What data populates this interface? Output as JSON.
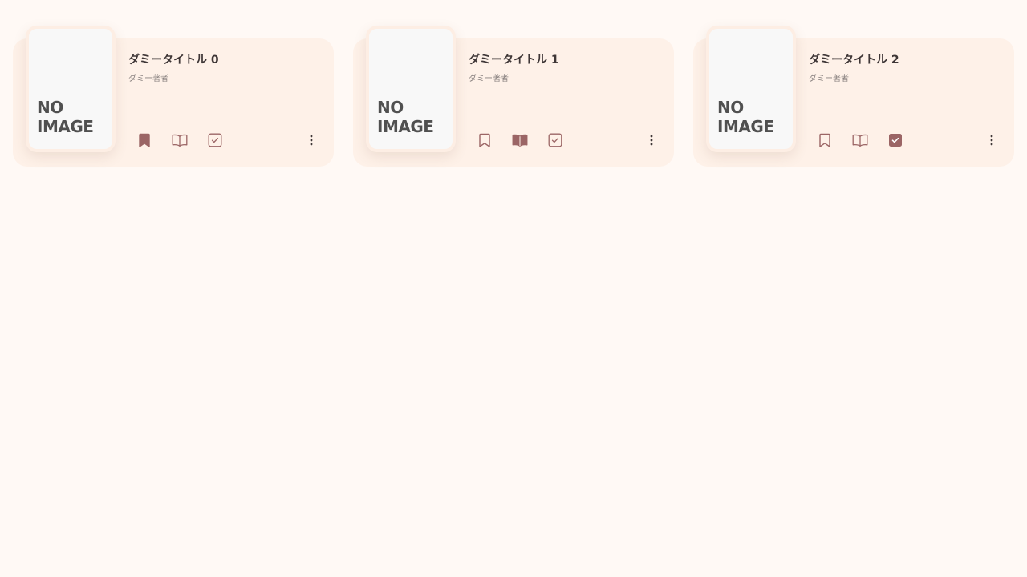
{
  "cards": [
    {
      "title": "ダミータイトル 0",
      "author": "ダミー著者",
      "cover_text": "NO\nIMAGE",
      "states": {
        "bookmark": true,
        "reading": false,
        "done": false
      }
    },
    {
      "title": "ダミータイトル 1",
      "author": "ダミー著者",
      "cover_text": "NO\nIMAGE",
      "states": {
        "bookmark": false,
        "reading": true,
        "done": false
      }
    },
    {
      "title": "ダミータイトル 2",
      "author": "ダミー著者",
      "cover_text": "NO\nIMAGE",
      "states": {
        "bookmark": false,
        "reading": false,
        "done": true
      }
    }
  ],
  "colors": {
    "background": "#fff9f5",
    "card": "#fef1e8",
    "accent": "#9b6565",
    "title": "#3e3636",
    "subtitle": "#8a8280"
  },
  "icons": [
    "bookmark-icon",
    "open-book-icon",
    "checkbox-icon",
    "more-vert-icon"
  ]
}
